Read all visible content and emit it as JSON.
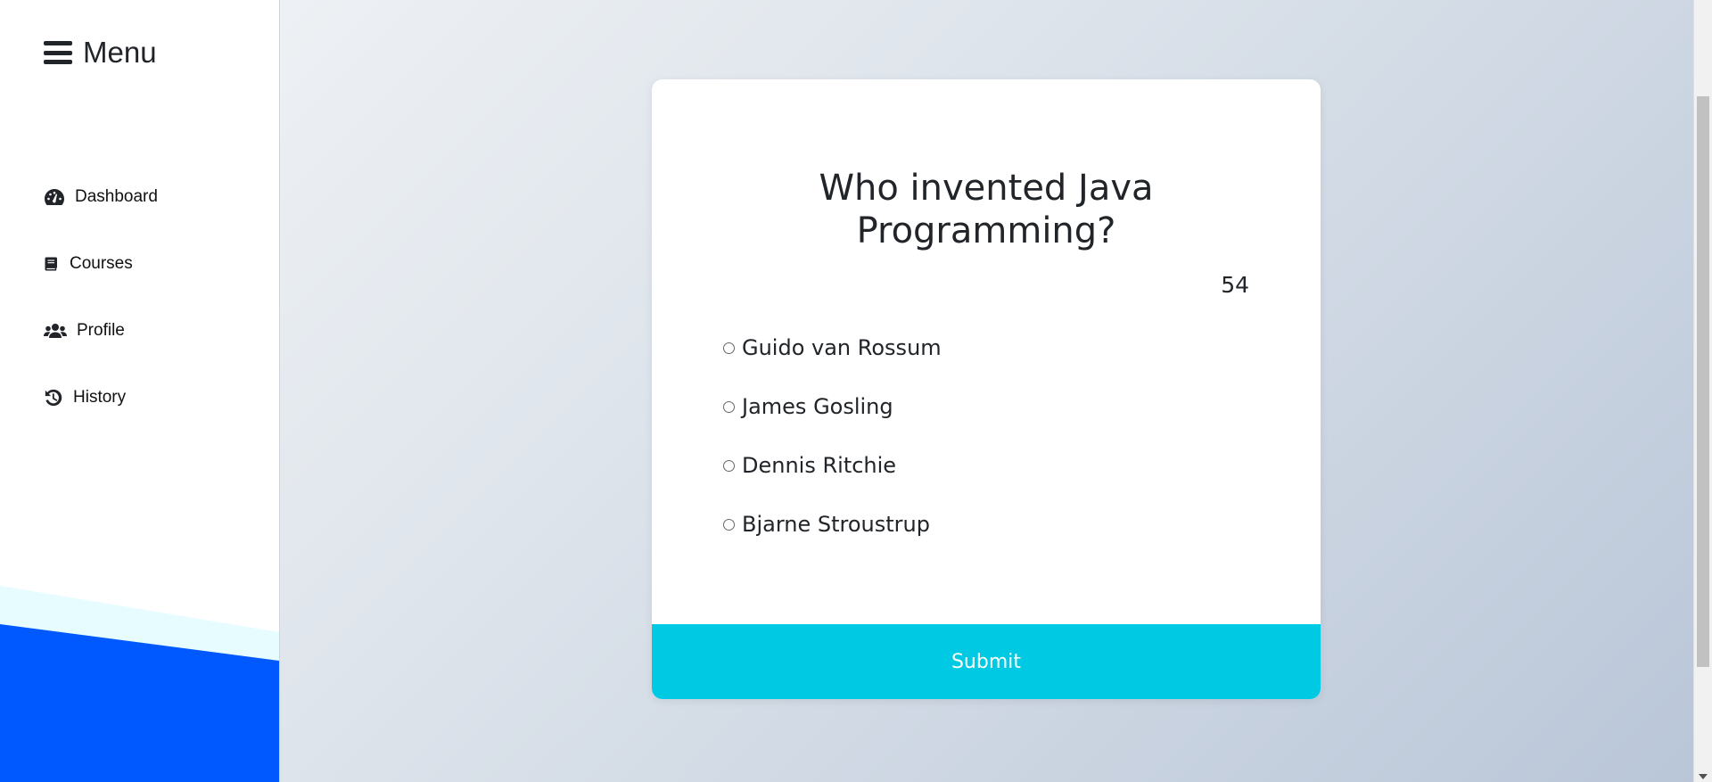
{
  "sidebar": {
    "menu_title": "Menu",
    "items": [
      {
        "label": "Dashboard",
        "icon": "tachometer-icon"
      },
      {
        "label": "Courses",
        "icon": "book-icon"
      },
      {
        "label": "Profile",
        "icon": "users-icon"
      },
      {
        "label": "History",
        "icon": "history-icon"
      }
    ]
  },
  "quiz": {
    "question": "Who invented Java Programming?",
    "timer": "54",
    "options": [
      "Guido van Rossum",
      "James Gosling",
      "Dennis Ritchie",
      "Bjarne Stroustrup"
    ],
    "submit_label": "Submit"
  },
  "colors": {
    "accent": "#00c9e3",
    "sidebar_deco_blue": "#0059ff",
    "sidebar_deco_light": "#e6fcff"
  }
}
